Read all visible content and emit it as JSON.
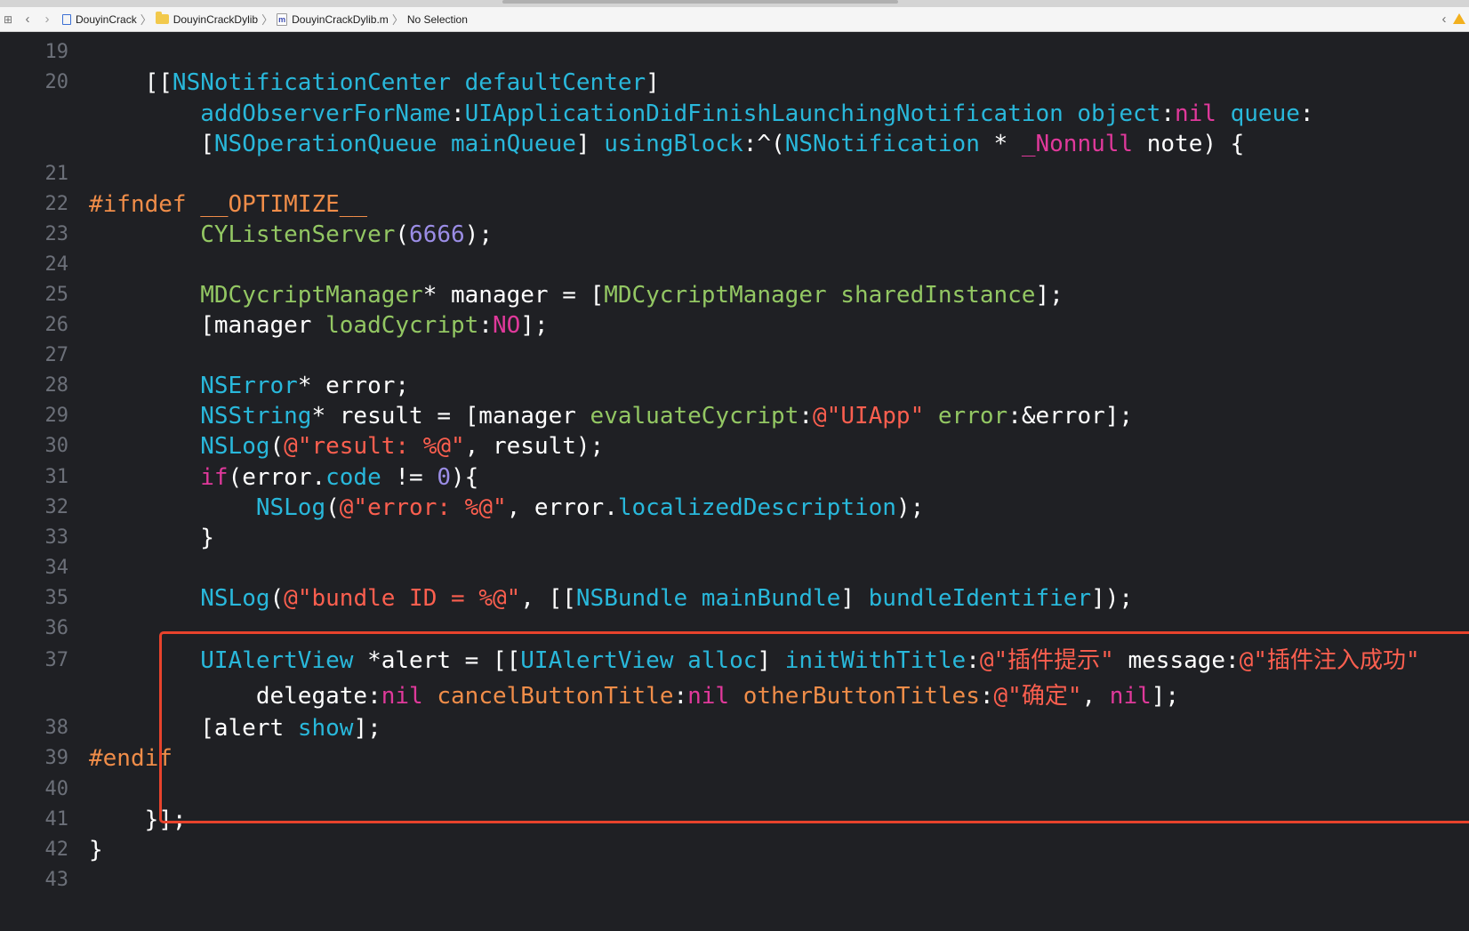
{
  "jump_bar": {
    "crumbs": [
      {
        "label": "DouyinCrack",
        "icon": "project-file-icon"
      },
      {
        "label": "DouyinCrackDylib",
        "icon": "folder-icon"
      },
      {
        "label": "DouyinCrackDylib.m",
        "icon": "m-file-icon"
      },
      {
        "label": "No Selection",
        "icon": ""
      }
    ]
  },
  "highlight_color": "#e8432c",
  "lines": [
    {
      "num": "19",
      "segs": []
    },
    {
      "num": "20",
      "segs": [
        [
          "plain",
          "    [["
        ],
        [
          "cls",
          "NSNotificationCenter"
        ],
        [
          "plain",
          " "
        ],
        [
          "meth",
          "defaultCenter"
        ],
        [
          "plain",
          "]"
        ]
      ]
    },
    {
      "num": "",
      "segs": [
        [
          "plain",
          "        "
        ],
        [
          "meth",
          "addObserverForName"
        ],
        [
          "plain",
          ":"
        ],
        [
          "meth",
          "UIApplicationDidFinishLaunchingNotification"
        ],
        [
          "plain",
          " "
        ],
        [
          "meth",
          "object"
        ],
        [
          "plain",
          ":"
        ],
        [
          "kw",
          "nil"
        ],
        [
          "plain",
          " "
        ],
        [
          "meth",
          "queue"
        ],
        [
          "plain",
          ":"
        ]
      ]
    },
    {
      "num": "",
      "segs": [
        [
          "plain",
          "        ["
        ],
        [
          "cls",
          "NSOperationQueue"
        ],
        [
          "plain",
          " "
        ],
        [
          "meth",
          "mainQueue"
        ],
        [
          "plain",
          "] "
        ],
        [
          "meth",
          "usingBlock"
        ],
        [
          "plain",
          ":^("
        ],
        [
          "cls",
          "NSNotification"
        ],
        [
          "plain",
          " * "
        ],
        [
          "nn",
          "_Nonnull"
        ],
        [
          "plain",
          " note) {"
        ]
      ]
    },
    {
      "num": "21",
      "segs": []
    },
    {
      "num": "22",
      "segs": [
        [
          "pre",
          "#ifndef __OPTIMIZE__"
        ]
      ]
    },
    {
      "num": "23",
      "segs": [
        [
          "plain",
          "        "
        ],
        [
          "proj",
          "CYListenServer"
        ],
        [
          "plain",
          "("
        ],
        [
          "num",
          "6666"
        ],
        [
          "plain",
          ");"
        ]
      ]
    },
    {
      "num": "24",
      "segs": []
    },
    {
      "num": "25",
      "segs": [
        [
          "plain",
          "        "
        ],
        [
          "proj",
          "MDCycriptManager"
        ],
        [
          "plain",
          "* manager = ["
        ],
        [
          "proj",
          "MDCycriptManager"
        ],
        [
          "plain",
          " "
        ],
        [
          "proj",
          "sharedInstance"
        ],
        [
          "plain",
          "];"
        ]
      ]
    },
    {
      "num": "26",
      "segs": [
        [
          "plain",
          "        [manager "
        ],
        [
          "proj",
          "loadCycript"
        ],
        [
          "plain",
          ":"
        ],
        [
          "kw",
          "NO"
        ],
        [
          "plain",
          "];"
        ]
      ]
    },
    {
      "num": "27",
      "segs": []
    },
    {
      "num": "28",
      "segs": [
        [
          "plain",
          "        "
        ],
        [
          "cls",
          "NSError"
        ],
        [
          "plain",
          "* error;"
        ]
      ]
    },
    {
      "num": "29",
      "segs": [
        [
          "plain",
          "        "
        ],
        [
          "cls",
          "NSString"
        ],
        [
          "plain",
          "* result = [manager "
        ],
        [
          "proj",
          "evaluateCycript"
        ],
        [
          "plain",
          ":"
        ],
        [
          "str",
          "@\"UIApp\""
        ],
        [
          "plain",
          " "
        ],
        [
          "proj",
          "error"
        ],
        [
          "plain",
          ":&error];"
        ]
      ]
    },
    {
      "num": "30",
      "segs": [
        [
          "plain",
          "        "
        ],
        [
          "meth",
          "NSLog"
        ],
        [
          "plain",
          "("
        ],
        [
          "str",
          "@\"result: %@\""
        ],
        [
          "plain",
          ", result);"
        ]
      ]
    },
    {
      "num": "31",
      "segs": [
        [
          "plain",
          "        "
        ],
        [
          "kw",
          "if"
        ],
        [
          "plain",
          "(error."
        ],
        [
          "meth",
          "code"
        ],
        [
          "plain",
          " != "
        ],
        [
          "num",
          "0"
        ],
        [
          "plain",
          "){"
        ]
      ]
    },
    {
      "num": "32",
      "segs": [
        [
          "plain",
          "            "
        ],
        [
          "meth",
          "NSLog"
        ],
        [
          "plain",
          "("
        ],
        [
          "str",
          "@\"error: %@\""
        ],
        [
          "plain",
          ", error."
        ],
        [
          "meth",
          "localizedDescription"
        ],
        [
          "plain",
          ");"
        ]
      ]
    },
    {
      "num": "33",
      "segs": [
        [
          "plain",
          "        }"
        ]
      ]
    },
    {
      "num": "34",
      "segs": []
    },
    {
      "num": "35",
      "segs": [
        [
          "plain",
          "        "
        ],
        [
          "meth",
          "NSLog"
        ],
        [
          "plain",
          "("
        ],
        [
          "str",
          "@\"bundle ID = %@\""
        ],
        [
          "plain",
          ", [["
        ],
        [
          "cls",
          "NSBundle"
        ],
        [
          "plain",
          " "
        ],
        [
          "meth",
          "mainBundle"
        ],
        [
          "plain",
          "] "
        ],
        [
          "meth",
          "bundleIdentifier"
        ],
        [
          "plain",
          "]);"
        ]
      ]
    },
    {
      "num": "36",
      "segs": []
    },
    {
      "num": "37",
      "segs": [
        [
          "plain",
          "        "
        ],
        [
          "cls",
          "UIAlertView"
        ],
        [
          "plain",
          " *alert = [["
        ],
        [
          "cls",
          "UIAlertView"
        ],
        [
          "plain",
          " "
        ],
        [
          "meth",
          "alloc"
        ],
        [
          "plain",
          "] "
        ],
        [
          "meth",
          "initWithTitle"
        ],
        [
          "plain",
          ":"
        ],
        [
          "str",
          "@\"插件提示\""
        ],
        [
          "plain",
          " message:"
        ],
        [
          "str",
          "@\"插件注入成功\""
        ]
      ]
    },
    {
      "num": "",
      "segs": [
        [
          "plain",
          "            delegate:"
        ],
        [
          "kw",
          "nil"
        ],
        [
          "plain",
          " "
        ],
        [
          "pre",
          "cancelButtonTitle"
        ],
        [
          "plain",
          ":"
        ],
        [
          "kw",
          "nil"
        ],
        [
          "plain",
          " "
        ],
        [
          "pre",
          "otherButtonTitles"
        ],
        [
          "plain",
          ":"
        ],
        [
          "str",
          "@\"确定\""
        ],
        [
          "plain",
          ", "
        ],
        [
          "kw",
          "nil"
        ],
        [
          "plain",
          "];"
        ]
      ]
    },
    {
      "num": "38",
      "segs": [
        [
          "plain",
          "        [alert "
        ],
        [
          "meth",
          "show"
        ],
        [
          "plain",
          "];"
        ]
      ]
    },
    {
      "num": "39",
      "segs": [
        [
          "pre",
          "#endif"
        ]
      ]
    },
    {
      "num": "40",
      "segs": []
    },
    {
      "num": "41",
      "segs": [
        [
          "plain",
          "    }];"
        ]
      ]
    },
    {
      "num": "42",
      "segs": [
        [
          "plain",
          "}"
        ]
      ]
    },
    {
      "num": "43",
      "segs": []
    }
  ]
}
